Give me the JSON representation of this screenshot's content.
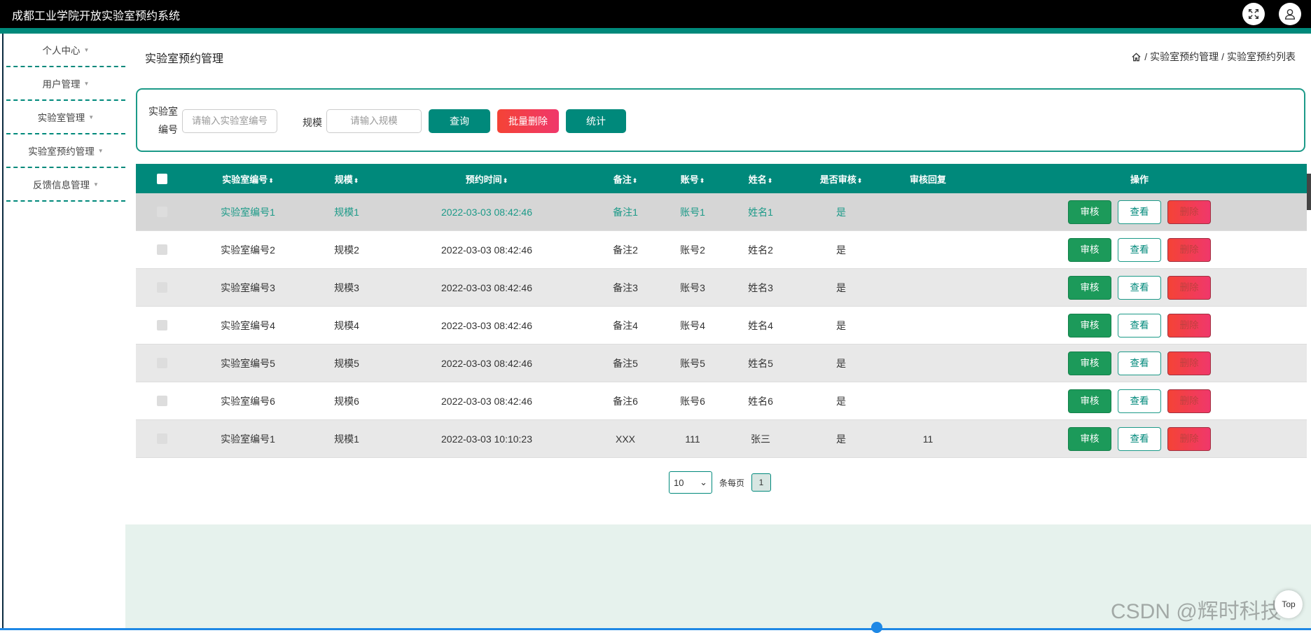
{
  "app": {
    "title": "成都工业学院开放实验室预约系统"
  },
  "header_icons": [
    "fullscreen-icon",
    "user-icon"
  ],
  "sidebar": {
    "items": [
      {
        "label": "个人中心"
      },
      {
        "label": "用户管理"
      },
      {
        "label": "实验室管理"
      },
      {
        "label": "实验室预约管理"
      },
      {
        "label": "反馈信息管理"
      }
    ]
  },
  "page": {
    "title": "实验室预约管理"
  },
  "breadcrumb": {
    "sep": "/",
    "items": [
      "实验室预约管理",
      "实验室预约列表"
    ]
  },
  "search": {
    "code_label": "实验室编号",
    "code_placeholder": "请输入实验室编号",
    "scale_label": "规模",
    "scale_placeholder": "请输入规模",
    "query_button": "查询",
    "batch_delete_button": "批量删除",
    "stats_button": "统计"
  },
  "table": {
    "sort_glyph": "⬍",
    "headers": {
      "code": "实验室编号",
      "scale": "规模",
      "time": "预约时间",
      "note": "备注",
      "account": "账号",
      "name": "姓名",
      "audit": "是否审核",
      "reply": "审核回复",
      "ops": "操作"
    },
    "rows": [
      {
        "code": "实验室编号1",
        "scale": "规模1",
        "time": "2022-03-03 08:42:46",
        "note": "备注1",
        "account": "账号1",
        "name": "姓名1",
        "audit": "是",
        "reply": ""
      },
      {
        "code": "实验室编号2",
        "scale": "规模2",
        "time": "2022-03-03 08:42:46",
        "note": "备注2",
        "account": "账号2",
        "name": "姓名2",
        "audit": "是",
        "reply": ""
      },
      {
        "code": "实验室编号3",
        "scale": "规模3",
        "time": "2022-03-03 08:42:46",
        "note": "备注3",
        "account": "账号3",
        "name": "姓名3",
        "audit": "是",
        "reply": ""
      },
      {
        "code": "实验室编号4",
        "scale": "规模4",
        "time": "2022-03-03 08:42:46",
        "note": "备注4",
        "account": "账号4",
        "name": "姓名4",
        "audit": "是",
        "reply": ""
      },
      {
        "code": "实验室编号5",
        "scale": "规模5",
        "time": "2022-03-03 08:42:46",
        "note": "备注5",
        "account": "账号5",
        "name": "姓名5",
        "audit": "是",
        "reply": ""
      },
      {
        "code": "实验室编号6",
        "scale": "规模6",
        "time": "2022-03-03 08:42:46",
        "note": "备注6",
        "account": "账号6",
        "name": "姓名6",
        "audit": "是",
        "reply": ""
      },
      {
        "code": "实验室编号1",
        "scale": "规模1",
        "time": "2022-03-03 10:10:23",
        "note": "XXX",
        "account": "111",
        "name": "张三",
        "audit": "是",
        "reply": "11"
      }
    ],
    "row_actions": {
      "audit": "审核",
      "view": "查看",
      "delete": "删除"
    }
  },
  "pagination": {
    "page_size": "10",
    "per_page_label": "条每页",
    "current_page": "1"
  },
  "back_to_top": "Top",
  "watermark": "CSDN @辉时科技",
  "colors": {
    "primary": "#00897b",
    "danger": "#f44336",
    "header_bg": "#000000",
    "bottom_band": "#e6f2ed"
  }
}
